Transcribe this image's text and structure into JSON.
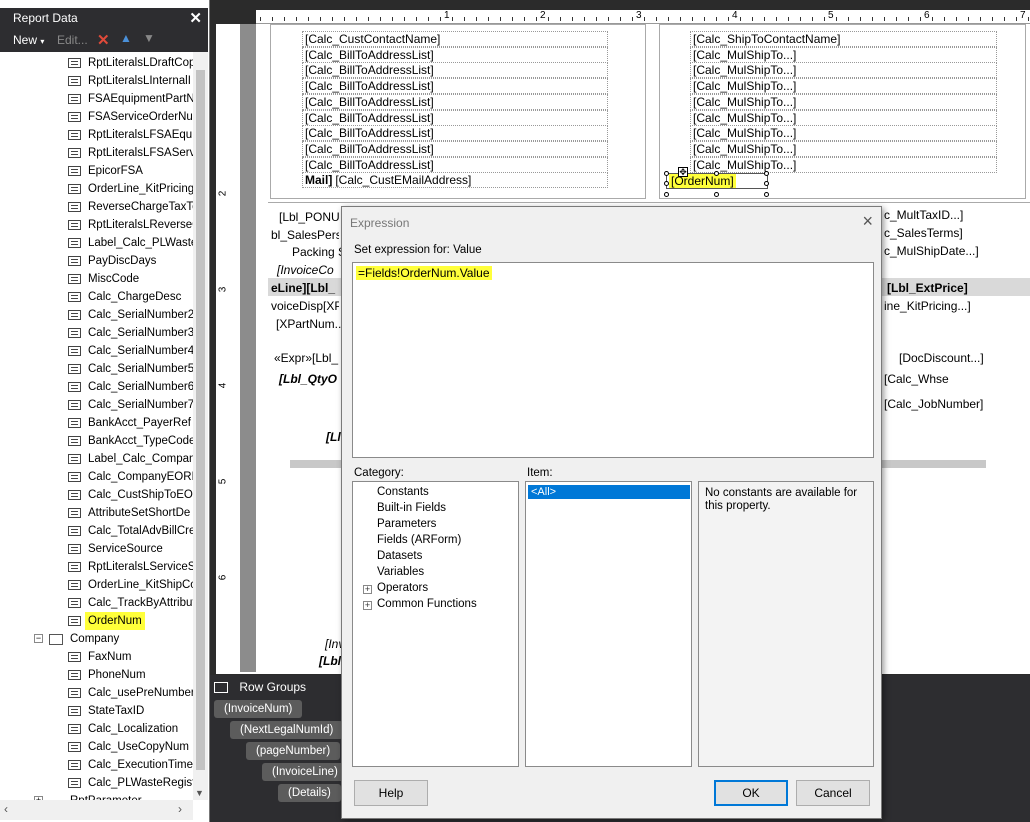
{
  "report_data": {
    "title": "Report Data",
    "close": "✕",
    "toolbar": {
      "new": "New",
      "edit": "Edit...",
      "delete_icon": "delete-icon",
      "up_icon": "arrow-up-icon",
      "down_icon": "arrow-down-icon"
    },
    "fields": [
      "RptLiteralsLDraftCop",
      "RptLiteralsLInternalI",
      "FSAEquipmentPartN",
      "FSAServiceOrderNur",
      "RptLiteralsLFSAEqui",
      "RptLiteralsLFSAServi",
      "EpicorFSA",
      "OrderLine_KitPricing",
      "ReverseChargeTaxTc",
      "RptLiteralsLReverseC",
      "Label_Calc_PLWaste",
      "PayDiscDays",
      "MiscCode",
      "Calc_ChargeDesc",
      "Calc_SerialNumber2",
      "Calc_SerialNumber3",
      "Calc_SerialNumber4",
      "Calc_SerialNumber5",
      "Calc_SerialNumber6",
      "Calc_SerialNumber7",
      "BankAcct_PayerRef",
      "BankAcct_TypeCode",
      "Label_Calc_Company",
      "Calc_CompanyEORI",
      "Calc_CustShipToEOI",
      "AttributeSetShortDe",
      "Calc_TotalAdvBillCre",
      "ServiceSource",
      "RptLiteralsLServiceS",
      "OrderLine_KitShipCo",
      "Calc_TrackByAttribut",
      "OrderNum"
    ],
    "dataset_company": "Company",
    "company_fields": [
      "FaxNum",
      "PhoneNum",
      "Calc_usePreNumber",
      "StateTaxID",
      "Calc_Localization",
      "Calc_UseCopyNum",
      "Calc_ExecutionTime",
      "Calc_PLWasteRegist"
    ],
    "dataset_rptparameter": "RptParameter"
  },
  "ruler": {
    "marks": [
      "1",
      "2",
      "3",
      "4",
      "5",
      "6",
      "7"
    ],
    "left_marks": [
      "2",
      "3",
      "4",
      "5",
      "6"
    ]
  },
  "report": {
    "billto": [
      "[Calc_CustContactName]",
      "[Calc_BillToAddressList]",
      "[Calc_BillToAddressList]",
      "[Calc_BillToAddressList]",
      "[Calc_BillToAddressList]",
      "[Calc_BillToAddressList]",
      "[Calc_BillToAddressList]",
      "[Calc_BillToAddressList]",
      "[Calc_BillToAddressList]"
    ],
    "email_label": "Mail]",
    "email_value": "[Calc_CustEMailAddress]",
    "shipto": [
      "[Calc_ShipToContactName]",
      "[Calc_MulShipTo...]",
      "[Calc_MulShipTo...]",
      "[Calc_MulShipTo...]",
      "[Calc_MulShipTo...]",
      "[Calc_MulShipTo...]",
      "[Calc_MulShipTo...]",
      "[Calc_MulShipTo...]",
      "[Calc_MulShipTo...]"
    ],
    "ordernum_cell": "[OrderNum]",
    "left_cells": [
      "[Lbl_PONU",
      "bl_SalesPers",
      "Packing S",
      "[InvoiceCo",
      "eLine][Lbl_",
      "voiceDisp[XP",
      "[XPartNum...",
      "«Expr»[Lbl_",
      "[Lbl_QtyO",
      "[Ll",
      "[Inv",
      "[Lbl"
    ],
    "right_cells": [
      "c_MultTaxID...]",
      "c_SalesTerms]",
      "c_MulShipDate...]",
      "[Lbl_ExtPrice]",
      "ine_KitPricing...]",
      "[DocDiscount...]",
      "[Calc_Whse",
      "[Calc_JobNumber]"
    ]
  },
  "row_groups": {
    "title": "Row Groups",
    "items": [
      "(InvoiceNum)",
      "(NextLegalNumId)",
      "(pageNumber)",
      "(InvoiceLine)",
      "(Details)"
    ]
  },
  "dialog": {
    "title": "Expression",
    "set_for": "Set expression for: Value",
    "expression": "=Fields!OrderNum.Value",
    "category_label": "Category:",
    "item_label": "Item:",
    "categories": [
      "Constants",
      "Built-in Fields",
      "Parameters",
      "Fields (ARForm)",
      "Datasets",
      "Variables",
      "Operators",
      "Common Functions"
    ],
    "item_selected": "<All>",
    "info": "No constants are available for this property.",
    "help": "Help",
    "ok": "OK",
    "cancel": "Cancel"
  },
  "colors": {
    "highlight": "#ffff3a",
    "panel_dark": "#2d2d30",
    "accent": "#0078d7"
  }
}
